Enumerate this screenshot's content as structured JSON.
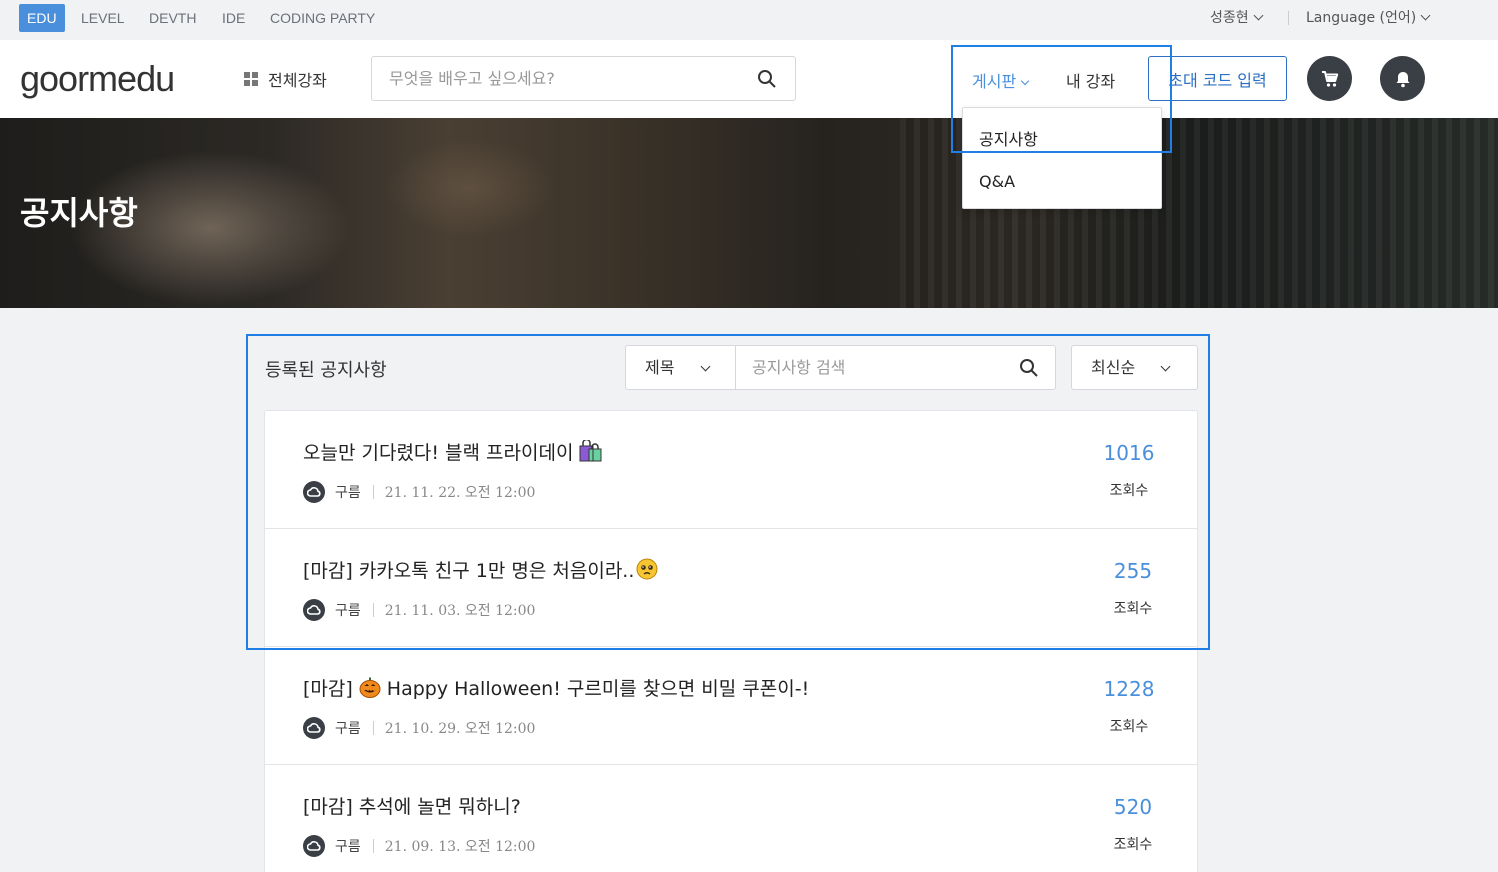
{
  "topbar": {
    "tabs": [
      "EDU",
      "LEVEL",
      "DEVTH",
      "IDE",
      "CODING PARTY"
    ],
    "user_name": "성종현",
    "language": "Language (언어)"
  },
  "header": {
    "logo": "goormedu",
    "all_courses": "전체강좌",
    "search_placeholder": "무엇을 배우고 싶으세요?",
    "board": "게시판",
    "my_courses": "내 강좌",
    "invite_code": "초대 코드 입력",
    "icons": {
      "cart": "cart-icon",
      "bell": "bell-icon",
      "search": "search-icon"
    }
  },
  "board_dropdown": {
    "items": [
      "공지사항",
      "Q&A"
    ]
  },
  "hero": {
    "title": "공지사항"
  },
  "notices": {
    "heading": "등록된 공지사항",
    "filter": "제목",
    "search_placeholder": "공지사항 검색",
    "sort": "최신순",
    "views_label": "조회수",
    "items": [
      {
        "title": "오늘만 기다렸다! 블랙 프라이데이",
        "emoji": "shopping-bags-icon",
        "author": "구름",
        "date": "21. 11. 22. 오전 12:00",
        "views": "1016"
      },
      {
        "title": "[마감] 카카오톡 친구 1만 명은 처음이라..",
        "emoji": "pleading-face-icon",
        "author": "구름",
        "date": "21. 11. 03. 오전 12:00",
        "views": "255"
      },
      {
        "title_prefix": "[마감]",
        "title": "Happy Halloween! 구르미를 찾으면 비밀 쿠폰이-!",
        "emoji": "jack-o-lantern-icon",
        "author": "구름",
        "date": "21. 10. 29. 오전 12:00",
        "views": "1228"
      },
      {
        "title": "[마감] 추석에 놀면 뭐하니?",
        "author": "구름",
        "date": "21. 09. 13. 오전 12:00",
        "views": "520"
      }
    ]
  },
  "colors": {
    "accent": "#4a8fdc",
    "highlight_box": "#1f7fe6",
    "invite_border": "#2c6fc2",
    "dark_button": "#3a3e45"
  }
}
